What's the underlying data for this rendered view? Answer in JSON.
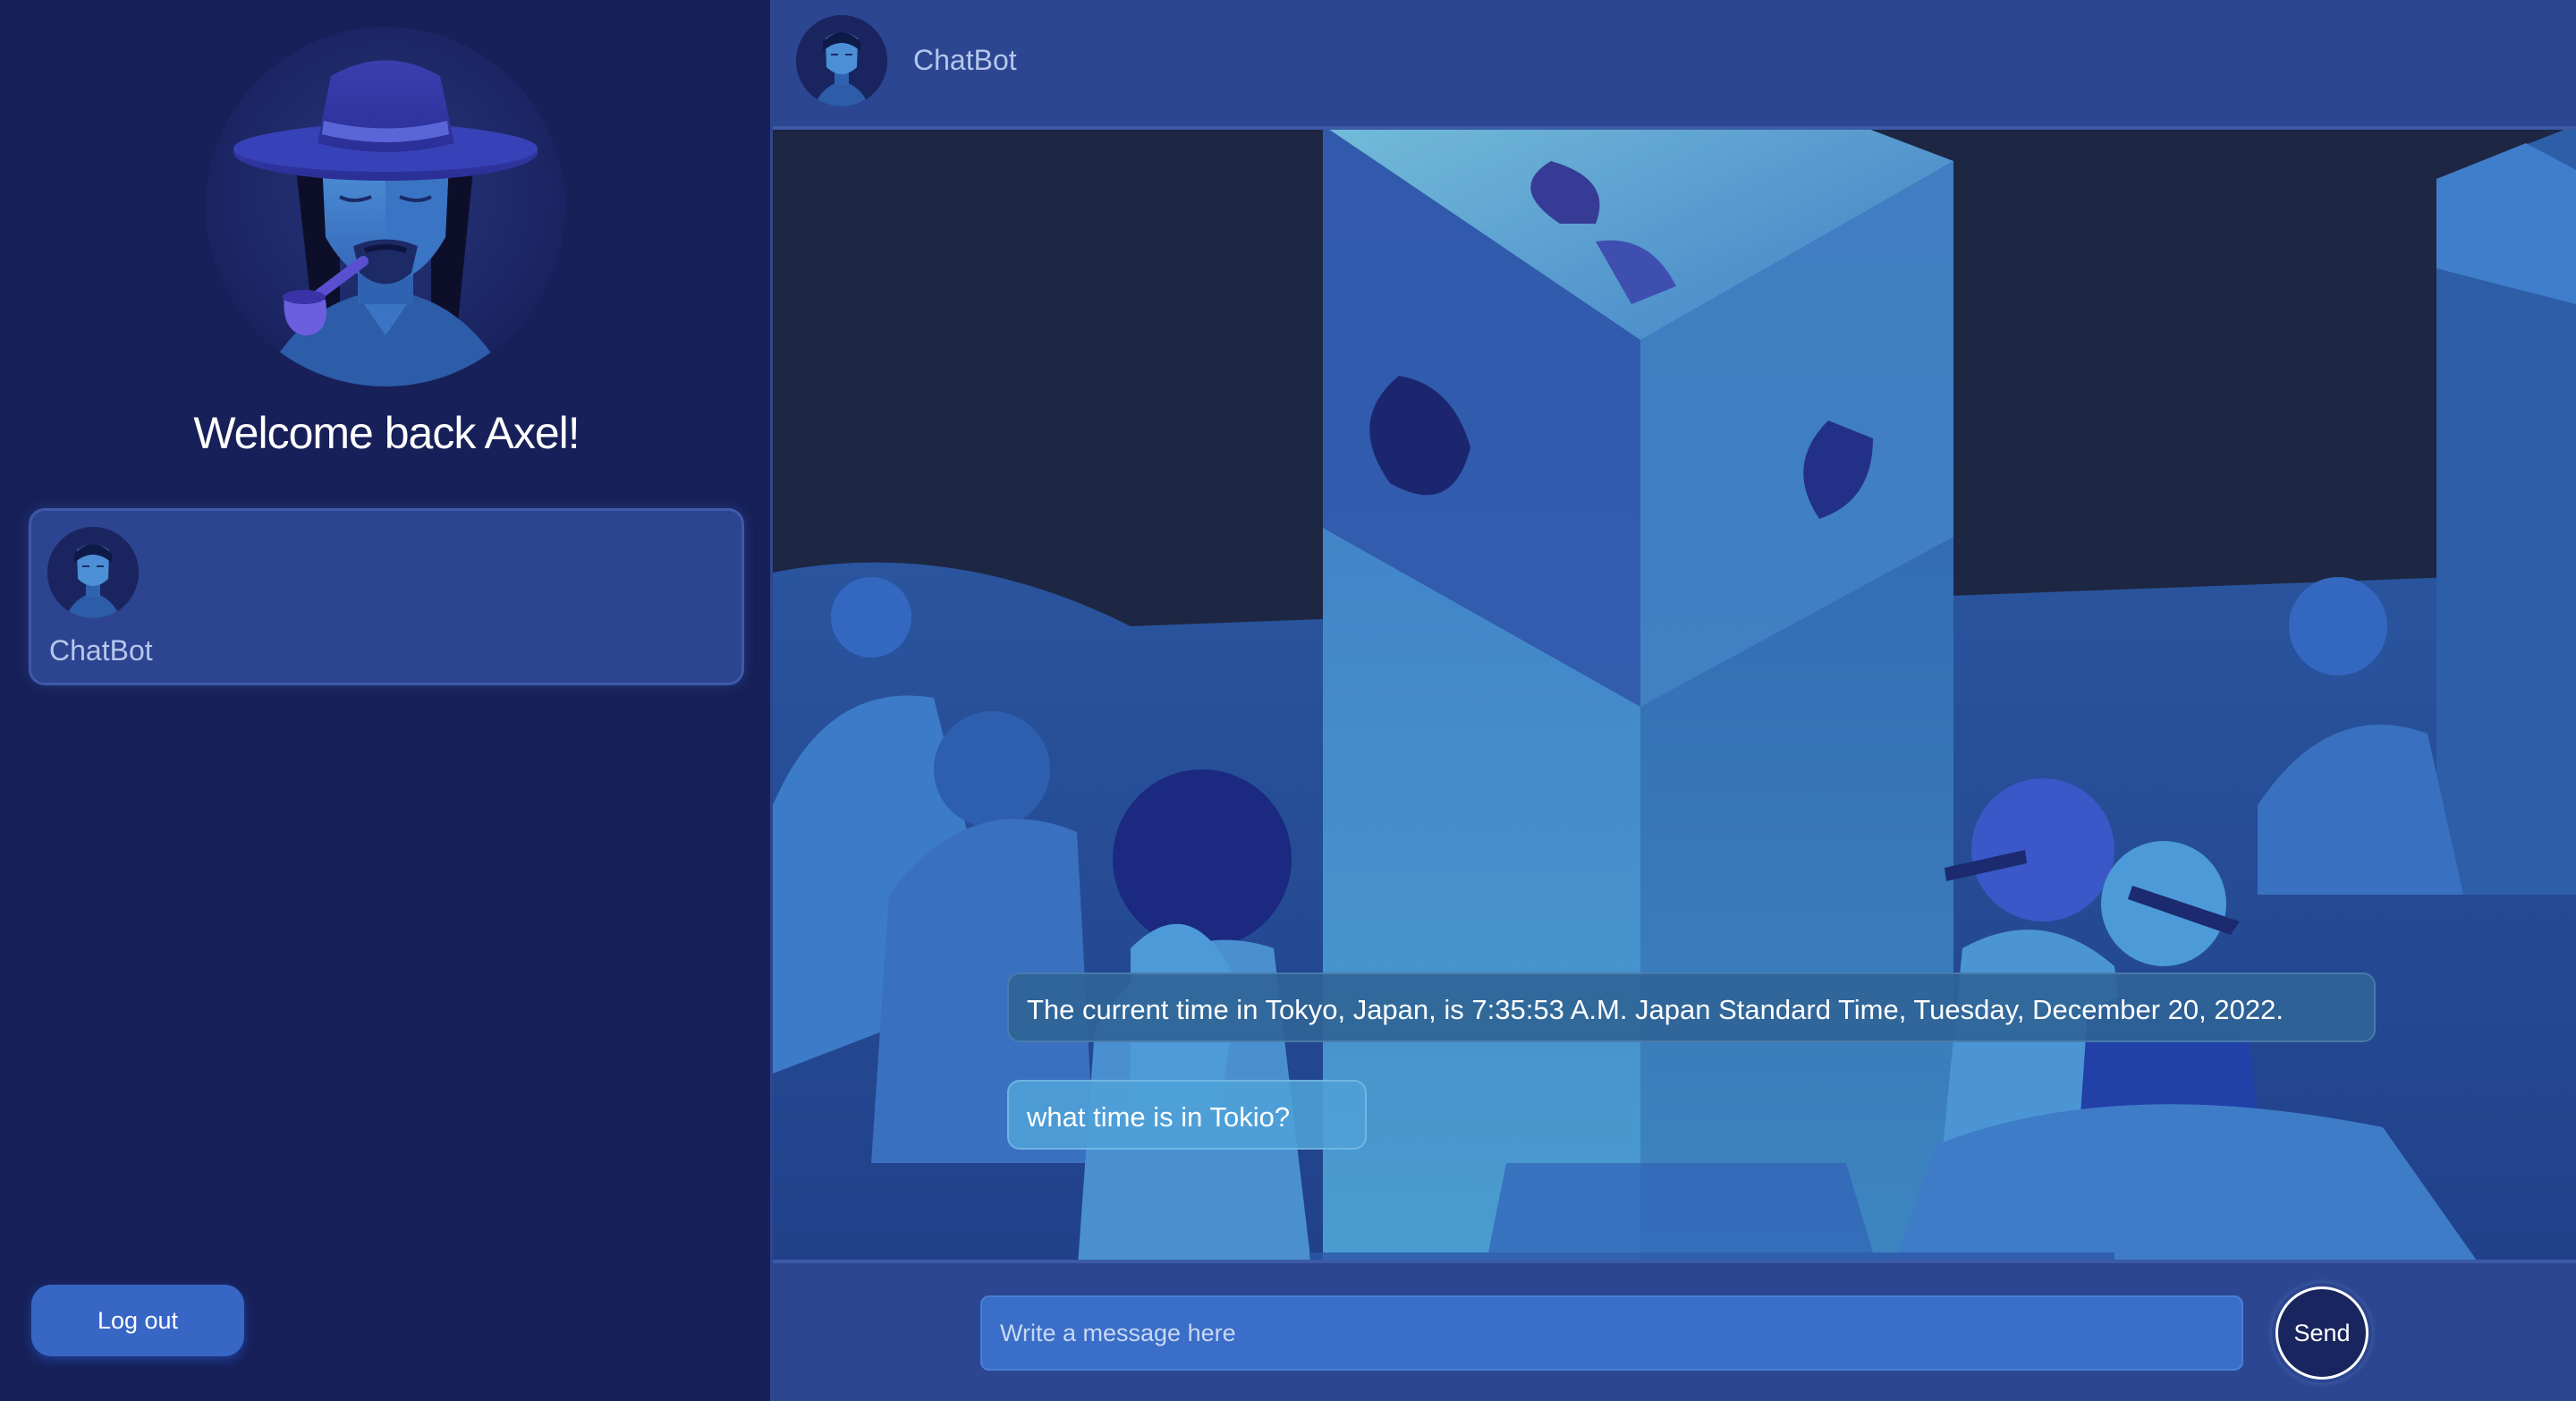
{
  "sidebar": {
    "welcome_text": "Welcome back Axel!",
    "contacts": [
      {
        "name": "ChatBot"
      }
    ],
    "logout_label": "Log out"
  },
  "chat": {
    "header_name": "ChatBot",
    "messages": [
      {
        "sender": "bot",
        "text": "The current time in Tokyo, Japan, is 7:35:53 A.M. Japan Standard Time, Tuesday, December 20, 2022."
      },
      {
        "sender": "user",
        "text": "what time is in Tokio?"
      }
    ],
    "input_placeholder": "Write a message here",
    "input_value": "",
    "send_label": "Send"
  },
  "colors": {
    "sidebar_bg": "#172058",
    "panel_bg": "#2c4691",
    "button_blue": "#3766c4",
    "bot_bubble": "#30649a",
    "user_bubble": "#4ea0d7"
  }
}
